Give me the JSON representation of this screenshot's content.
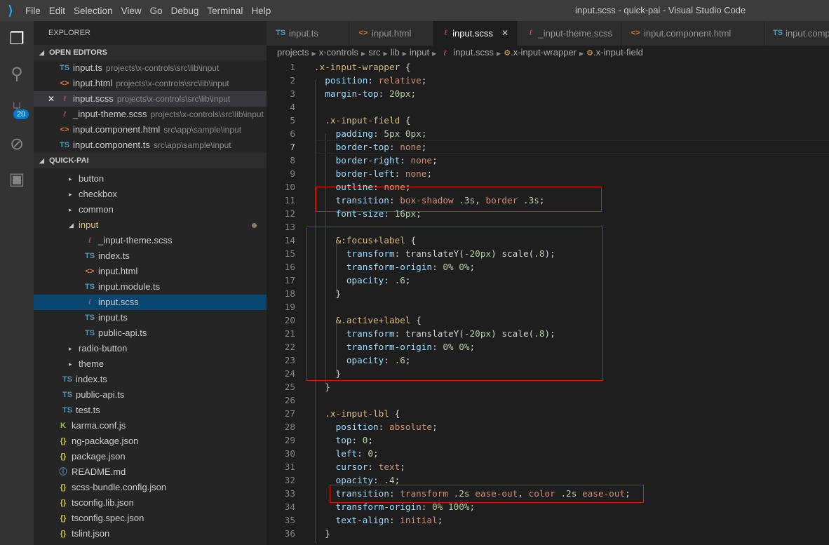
{
  "titlebar": {
    "menus": [
      "File",
      "Edit",
      "Selection",
      "View",
      "Go",
      "Debug",
      "Terminal",
      "Help"
    ],
    "title": "input.scss - quick-pai - Visual Studio Code"
  },
  "activity": {
    "scm_badge": "20"
  },
  "sidebar": {
    "title": "EXPLORER",
    "open_editors_label": "OPEN EDITORS",
    "open_editors": [
      {
        "icon": "ts",
        "name": "input.ts",
        "path": "projects\\x-controls\\src\\lib\\input"
      },
      {
        "icon": "html",
        "name": "input.html",
        "path": "projects\\x-controls\\src\\lib\\input"
      },
      {
        "icon": "scss",
        "name": "input.scss",
        "path": "projects\\x-controls\\src\\lib\\input",
        "selected": true
      },
      {
        "icon": "scss",
        "name": "_input-theme.scss",
        "path": "projects\\x-controls\\src\\lib\\input"
      },
      {
        "icon": "html",
        "name": "input.component.html",
        "path": "src\\app\\sample\\input"
      },
      {
        "icon": "ts",
        "name": "input.component.ts",
        "path": "src\\app\\sample\\input"
      }
    ],
    "project_label": "QUICK-PAI",
    "tree": [
      {
        "name": "button",
        "type": "folder",
        "level": 3
      },
      {
        "name": "checkbox",
        "type": "folder",
        "level": 3
      },
      {
        "name": "common",
        "type": "folder",
        "level": 3
      },
      {
        "name": "input",
        "type": "folder-open",
        "level": 3,
        "modified": true
      },
      {
        "name": "_input-theme.scss",
        "type": "scss",
        "level": 4
      },
      {
        "name": "index.ts",
        "type": "ts",
        "level": 4
      },
      {
        "name": "input.html",
        "type": "html",
        "level": 4
      },
      {
        "name": "input.module.ts",
        "type": "ts",
        "level": 4
      },
      {
        "name": "input.scss",
        "type": "scss",
        "level": 4,
        "active": true
      },
      {
        "name": "input.ts",
        "type": "ts",
        "level": 4
      },
      {
        "name": "public-api.ts",
        "type": "ts",
        "level": 4
      },
      {
        "name": "radio-button",
        "type": "folder",
        "level": 3
      },
      {
        "name": "theme",
        "type": "folder",
        "level": 3
      },
      {
        "name": "index.ts",
        "type": "ts",
        "level": 2
      },
      {
        "name": "public-api.ts",
        "type": "ts",
        "level": 2
      },
      {
        "name": "test.ts",
        "type": "ts",
        "level": 2
      },
      {
        "name": "karma.conf.js",
        "type": "karma",
        "level": 1
      },
      {
        "name": "ng-package.json",
        "type": "json",
        "level": 1
      },
      {
        "name": "package.json",
        "type": "json",
        "level": 1
      },
      {
        "name": "README.md",
        "type": "md",
        "level": 1
      },
      {
        "name": "scss-bundle.config.json",
        "type": "json",
        "level": 1
      },
      {
        "name": "tsconfig.lib.json",
        "type": "json",
        "level": 1
      },
      {
        "name": "tsconfig.spec.json",
        "type": "json",
        "level": 1
      },
      {
        "name": "tslint.json",
        "type": "json",
        "level": 1
      }
    ]
  },
  "tabs": [
    {
      "icon": "ts",
      "label": "input.ts"
    },
    {
      "icon": "html",
      "label": "input.html"
    },
    {
      "icon": "scss",
      "label": "input.scss",
      "active": true
    },
    {
      "icon": "scss",
      "label": "_input-theme.scss"
    },
    {
      "icon": "html",
      "label": "input.component.html"
    },
    {
      "icon": "ts",
      "label": "input.component.ts"
    }
  ],
  "breadcrumbs": [
    "projects",
    "x-controls",
    "src",
    "lib",
    "input",
    "input.scss",
    ".x-input-wrapper",
    ".x-input-field"
  ],
  "editor": {
    "current_line": 7,
    "lines": [
      [
        [
          "s",
          ".x-input-wrapper"
        ],
        [
          "t",
          " {"
        ]
      ],
      [
        [
          "t",
          "  "
        ],
        [
          "p",
          "position"
        ],
        [
          "t",
          ": "
        ],
        [
          "v",
          "relative"
        ],
        [
          "t",
          ";"
        ]
      ],
      [
        [
          "t",
          "  "
        ],
        [
          "p",
          "margin-top"
        ],
        [
          "t",
          ": "
        ],
        [
          "n",
          "20px"
        ],
        [
          "t",
          ";"
        ]
      ],
      [],
      [
        [
          "t",
          "  "
        ],
        [
          "s",
          ".x-input-field"
        ],
        [
          "t",
          " {"
        ]
      ],
      [
        [
          "t",
          "    "
        ],
        [
          "p",
          "padding"
        ],
        [
          "t",
          ": "
        ],
        [
          "n",
          "5px 0px"
        ],
        [
          "t",
          ";"
        ]
      ],
      [
        [
          "t",
          "    "
        ],
        [
          "p",
          "border-top"
        ],
        [
          "t",
          ": "
        ],
        [
          "v",
          "none"
        ],
        [
          "t",
          ";"
        ]
      ],
      [
        [
          "t",
          "    "
        ],
        [
          "p",
          "border-right"
        ],
        [
          "t",
          ": "
        ],
        [
          "v",
          "none"
        ],
        [
          "t",
          ";"
        ]
      ],
      [
        [
          "t",
          "    "
        ],
        [
          "p",
          "border-left"
        ],
        [
          "t",
          ": "
        ],
        [
          "v",
          "none"
        ],
        [
          "t",
          ";"
        ]
      ],
      [
        [
          "t",
          "    "
        ],
        [
          "p",
          "outline"
        ],
        [
          "t",
          ": "
        ],
        [
          "v",
          "none"
        ],
        [
          "t",
          ";"
        ]
      ],
      [
        [
          "t",
          "    "
        ],
        [
          "p",
          "transition"
        ],
        [
          "t",
          ": "
        ],
        [
          "v",
          "box-shadow"
        ],
        [
          "t",
          " "
        ],
        [
          "n",
          ".3s"
        ],
        [
          "t",
          ", "
        ],
        [
          "v",
          "border"
        ],
        [
          "t",
          " "
        ],
        [
          "n",
          ".3s"
        ],
        [
          "t",
          ";"
        ]
      ],
      [
        [
          "t",
          "    "
        ],
        [
          "p",
          "font-size"
        ],
        [
          "t",
          ": "
        ],
        [
          "n",
          "16px"
        ],
        [
          "t",
          ";"
        ]
      ],
      [],
      [
        [
          "t",
          "    "
        ],
        [
          "s",
          "&:focus+label"
        ],
        [
          "t",
          " {"
        ]
      ],
      [
        [
          "t",
          "      "
        ],
        [
          "p",
          "transform"
        ],
        [
          "t",
          ": translateY("
        ],
        [
          "n",
          "-20px"
        ],
        [
          "t",
          ") scale("
        ],
        [
          "n",
          ".8"
        ],
        [
          "t",
          ");"
        ]
      ],
      [
        [
          "t",
          "      "
        ],
        [
          "p",
          "transform-origin"
        ],
        [
          "t",
          ": "
        ],
        [
          "n",
          "0% 0%"
        ],
        [
          "t",
          ";"
        ]
      ],
      [
        [
          "t",
          "      "
        ],
        [
          "p",
          "opacity"
        ],
        [
          "t",
          ": "
        ],
        [
          "n",
          ".6"
        ],
        [
          "t",
          ";"
        ]
      ],
      [
        [
          "t",
          "    }"
        ]
      ],
      [],
      [
        [
          "t",
          "    "
        ],
        [
          "s",
          "&.active+label"
        ],
        [
          "t",
          " {"
        ]
      ],
      [
        [
          "t",
          "      "
        ],
        [
          "p",
          "transform"
        ],
        [
          "t",
          ": translateY("
        ],
        [
          "n",
          "-20px"
        ],
        [
          "t",
          ") scale("
        ],
        [
          "n",
          ".8"
        ],
        [
          "t",
          ");"
        ]
      ],
      [
        [
          "t",
          "      "
        ],
        [
          "p",
          "transform-origin"
        ],
        [
          "t",
          ": "
        ],
        [
          "n",
          "0% 0%"
        ],
        [
          "t",
          ";"
        ]
      ],
      [
        [
          "t",
          "      "
        ],
        [
          "p",
          "opacity"
        ],
        [
          "t",
          ": "
        ],
        [
          "n",
          ".6"
        ],
        [
          "t",
          ";"
        ]
      ],
      [
        [
          "t",
          "    }"
        ]
      ],
      [
        [
          "t",
          "  }"
        ]
      ],
      [],
      [
        [
          "t",
          "  "
        ],
        [
          "s",
          ".x-input-lbl"
        ],
        [
          "t",
          " {"
        ]
      ],
      [
        [
          "t",
          "    "
        ],
        [
          "p",
          "position"
        ],
        [
          "t",
          ": "
        ],
        [
          "v",
          "absolute"
        ],
        [
          "t",
          ";"
        ]
      ],
      [
        [
          "t",
          "    "
        ],
        [
          "p",
          "top"
        ],
        [
          "t",
          ": "
        ],
        [
          "n",
          "0"
        ],
        [
          "t",
          ";"
        ]
      ],
      [
        [
          "t",
          "    "
        ],
        [
          "p",
          "left"
        ],
        [
          "t",
          ": "
        ],
        [
          "n",
          "0"
        ],
        [
          "t",
          ";"
        ]
      ],
      [
        [
          "t",
          "    "
        ],
        [
          "p",
          "cursor"
        ],
        [
          "t",
          ": "
        ],
        [
          "v",
          "text"
        ],
        [
          "t",
          ";"
        ]
      ],
      [
        [
          "t",
          "    "
        ],
        [
          "p",
          "opacity"
        ],
        [
          "t",
          ": "
        ],
        [
          "n",
          ".4"
        ],
        [
          "t",
          ";"
        ]
      ],
      [
        [
          "t",
          "    "
        ],
        [
          "p",
          "transition"
        ],
        [
          "t",
          ": "
        ],
        [
          "v",
          "transform"
        ],
        [
          "t",
          " "
        ],
        [
          "n",
          ".2s"
        ],
        [
          "t",
          " "
        ],
        [
          "v",
          "ease-out"
        ],
        [
          "t",
          ", "
        ],
        [
          "v",
          "color"
        ],
        [
          "t",
          " "
        ],
        [
          "n",
          ".2s"
        ],
        [
          "t",
          " "
        ],
        [
          "v",
          "ease-out"
        ],
        [
          "t",
          ";"
        ]
      ],
      [
        [
          "t",
          "    "
        ],
        [
          "p",
          "transform-origin"
        ],
        [
          "t",
          ": "
        ],
        [
          "n",
          "0% 100%"
        ],
        [
          "t",
          ";"
        ]
      ],
      [
        [
          "t",
          "    "
        ],
        [
          "p",
          "text-align"
        ],
        [
          "t",
          ": "
        ],
        [
          "v",
          "initial"
        ],
        [
          "t",
          ";"
        ]
      ],
      [
        [
          "t",
          "  }"
        ]
      ]
    ]
  }
}
